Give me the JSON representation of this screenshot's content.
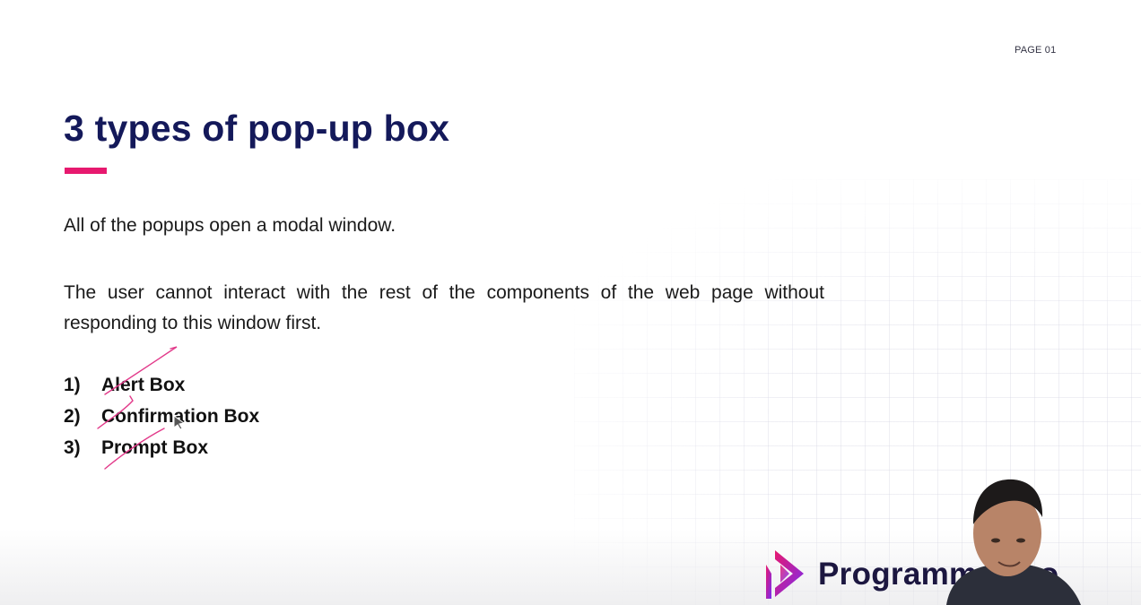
{
  "page_label": "PAGE 01",
  "title": "3 types of pop-up box",
  "paragraphs": {
    "first": "All of the popups open a modal window.",
    "second": "The user cannot interact with the rest of the components of the web page without responding to this window first."
  },
  "list": [
    {
      "number": "1)",
      "label": "Alert Box"
    },
    {
      "number": "2)",
      "label": "Confirmation Box"
    },
    {
      "number": "3)",
      "label": "Prompt Box"
    }
  ],
  "brand": {
    "name": "Programming Hero",
    "visible_text": "Programm Hero"
  },
  "colors": {
    "title": "#14195a",
    "accent": "#e7196f",
    "logo_gradient_start": "#e7196f",
    "logo_gradient_end": "#7a2cf0",
    "annotation": "#e23a8a"
  },
  "icons": {
    "brand_logo": "play-triangle-logo",
    "cursor": "mouse-pointer-icon"
  }
}
